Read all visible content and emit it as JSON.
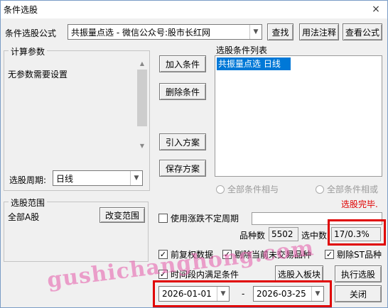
{
  "window": {
    "title": "条件选股",
    "close": "×"
  },
  "formula": {
    "label": "条件选股公式",
    "value": "共振量点选  -  微信公众号:股市长红网",
    "find": "查找",
    "usage": "用法注释",
    "view": "查看公式"
  },
  "params": {
    "title": "计算参数",
    "text": "无参数需要设置",
    "period_label": "选股周期:",
    "period_value": "日线"
  },
  "buttons": {
    "add": "加入条件",
    "remove": "删除条件",
    "import": "引入方案",
    "save": "保存方案"
  },
  "condition_list": {
    "title": "选股条件列表",
    "items": [
      "共振量点选  日线"
    ]
  },
  "logic": {
    "and_label": "全部条件相与",
    "or_label": "全部条件相或"
  },
  "status": "选股完毕.",
  "scope": {
    "title": "选股范围",
    "value": "全部A股",
    "change": "改变范围"
  },
  "uncertain_period": {
    "label": "使用涨跌不定周期",
    "checked": false
  },
  "stats": {
    "count_label": "品种数",
    "count": "5502",
    "selected_label": "选中数",
    "selected": "17/0.3%"
  },
  "options": [
    {
      "label": "前复权数据",
      "checked": true
    },
    {
      "label": "剔除当前未交易品种",
      "checked": true
    },
    {
      "label": "剔除ST品种",
      "checked": true
    }
  ],
  "time_range": {
    "label": "时间段内满足条件",
    "checked": true,
    "start": "2026-01-01",
    "dash": "-",
    "end": "2026-03-25"
  },
  "actions": {
    "to_block": "选股入板块",
    "run": "执行选股",
    "close": "关闭"
  },
  "watermark": "gushichanghong.com",
  "colors": {
    "highlight": "#e00000",
    "selection": "#0078d7",
    "status": "#e00000"
  }
}
